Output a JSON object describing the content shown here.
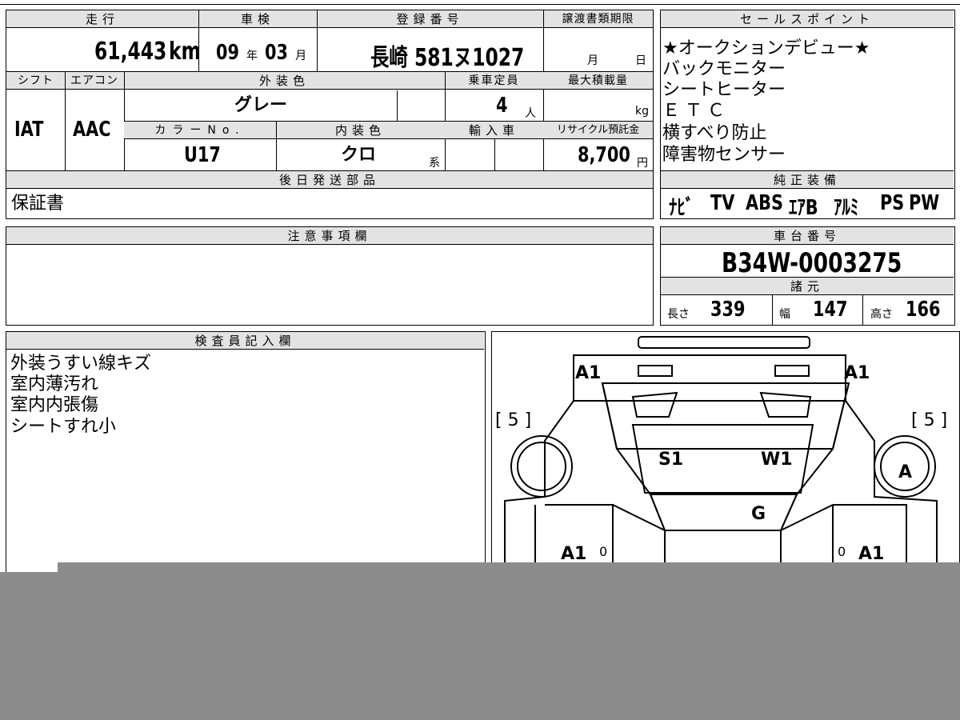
{
  "top": {
    "mileage_header": "走行",
    "mileage_value": "61,443",
    "mileage_unit": "km",
    "inspection_header": "車検",
    "inspection_year": "09",
    "inspection_year_unit": "年",
    "inspection_month": "03",
    "inspection_month_unit": "月",
    "reg_header": "登録番号",
    "reg_value": "長崎 581ヌ1027",
    "transfer_header": "譲渡書類期限",
    "transfer_month_unit": "月",
    "transfer_day_unit": "日",
    "shift_header": "シフト",
    "shift_value": "IAT",
    "aircon_header": "エアコン",
    "aircon_value": "AAC",
    "exterior_header": "外装色",
    "exterior_value": "グレー",
    "capacity_header": "乗車定員",
    "capacity_value": "4",
    "capacity_unit": "人",
    "maxload_header": "最大積載量",
    "maxload_unit": "kg",
    "colorno_header": "カラーNo.",
    "colorno_value": "U17",
    "interior_header": "内装色",
    "interior_value": "クロ",
    "interior_unit": "系",
    "import_header": "輸入車",
    "recycle_header": "リサイクル預託金",
    "recycle_value": "8,700",
    "recycle_unit": "円",
    "later_header": "後日発送部品",
    "later_value": "保証書"
  },
  "sales": {
    "header": "セールスポイント",
    "items": [
      "★オークションデビュー★",
      "バックモニター",
      "シートヒーター",
      "ＥＴＣ",
      "横すべり防止",
      "障害物センサー"
    ]
  },
  "equipment": {
    "header": "純正装備",
    "items": [
      "ﾅﾋﾞ",
      "TV",
      "ABS",
      "ｴｱB",
      "ｱﾙﾐ",
      "PS",
      "PW"
    ]
  },
  "notes": {
    "header": "注意事項欄"
  },
  "chassis": {
    "header": "車台番号",
    "value": "B34W-0003275"
  },
  "dims": {
    "header": "諸元",
    "length_label": "長さ",
    "length_value": "339",
    "width_label": "幅",
    "width_value": "147",
    "height_label": "高さ",
    "height_value": "166"
  },
  "inspector": {
    "header": "検査員記入欄",
    "lines": [
      "外装うすい線キズ",
      "室内薄汚れ",
      "室内内張傷",
      "シートすれ小"
    ]
  },
  "diagram": {
    "labels": {
      "rear_left": "A1",
      "rear_right": "A1",
      "side_left": "[ 5 ]",
      "side_right": "[ 5 ]",
      "seat": "S1",
      "wheel": "W1",
      "glass": "G",
      "tire_right": "A",
      "door_left": "A1",
      "door_right": "A1",
      "door_left_small": "0",
      "door_right_small": "0"
    }
  }
}
